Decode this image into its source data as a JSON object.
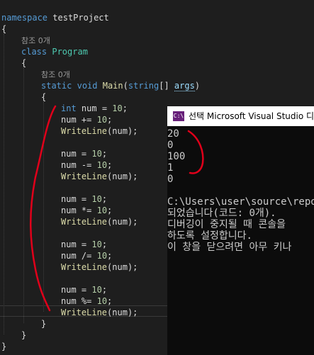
{
  "code": {
    "namespace_kw": "namespace",
    "namespace_name": "testProject",
    "open_brace": "{",
    "close_brace": "}",
    "refs_label": "참조 0개",
    "class_kw": "class",
    "class_name": "Program",
    "static_kw": "static",
    "void_kw": "void",
    "method_name": "Main",
    "paren_open": "(",
    "string_kw": "string",
    "array_brackets": "[] ",
    "param_name": "args",
    "paren_close": ")",
    "int_kw": "int",
    "lines": [
      {
        "var": "num",
        "op": " = ",
        "val": "10",
        "end": ";"
      },
      {
        "var": "num",
        "op": " += ",
        "val": "10",
        "end": ";"
      },
      {
        "call": "WriteLine",
        "arg": "num"
      },
      {
        "var": "num",
        "op": " = ",
        "val": "10",
        "end": ";"
      },
      {
        "var": "num",
        "op": " -= ",
        "val": "10",
        "end": ";"
      },
      {
        "call": "WriteLine",
        "arg": "num"
      },
      {
        "var": "num",
        "op": " = ",
        "val": "10",
        "end": ";"
      },
      {
        "var": "num",
        "op": " *= ",
        "val": "10",
        "end": ";"
      },
      {
        "call": "WriteLine",
        "arg": "num"
      },
      {
        "var": "num",
        "op": " = ",
        "val": "10",
        "end": ";"
      },
      {
        "var": "num",
        "op": " /= ",
        "val": "10",
        "end": ";"
      },
      {
        "call": "WriteLine",
        "arg": "num"
      },
      {
        "var": "num",
        "op": " = ",
        "val": "10",
        "end": ";"
      },
      {
        "var": "num",
        "op": " %= ",
        "val": "10",
        "end": ";"
      },
      {
        "call": "WriteLine",
        "arg": "num"
      }
    ]
  },
  "console": {
    "icon": "C:\\",
    "title": "선택 Microsoft Visual Studio 디버",
    "output": [
      "20",
      "0",
      "100",
      "1",
      "0"
    ],
    "messages": [
      "C:\\Users\\user\\source\\repos",
      "되었습니다(코드: 0개).",
      "디버깅이 중지될 때 콘솔을",
      "하도록 설정합니다.",
      "이 창을 닫으려면 아무 키나"
    ]
  },
  "colors": {
    "editor_bg": "#1e1e1e",
    "keyword": "#569cd6",
    "type": "#4ec9b0",
    "method": "#dcdcaa",
    "parameter": "#9cdcfe",
    "number": "#b5cea8",
    "annotation": "#e0001a"
  }
}
